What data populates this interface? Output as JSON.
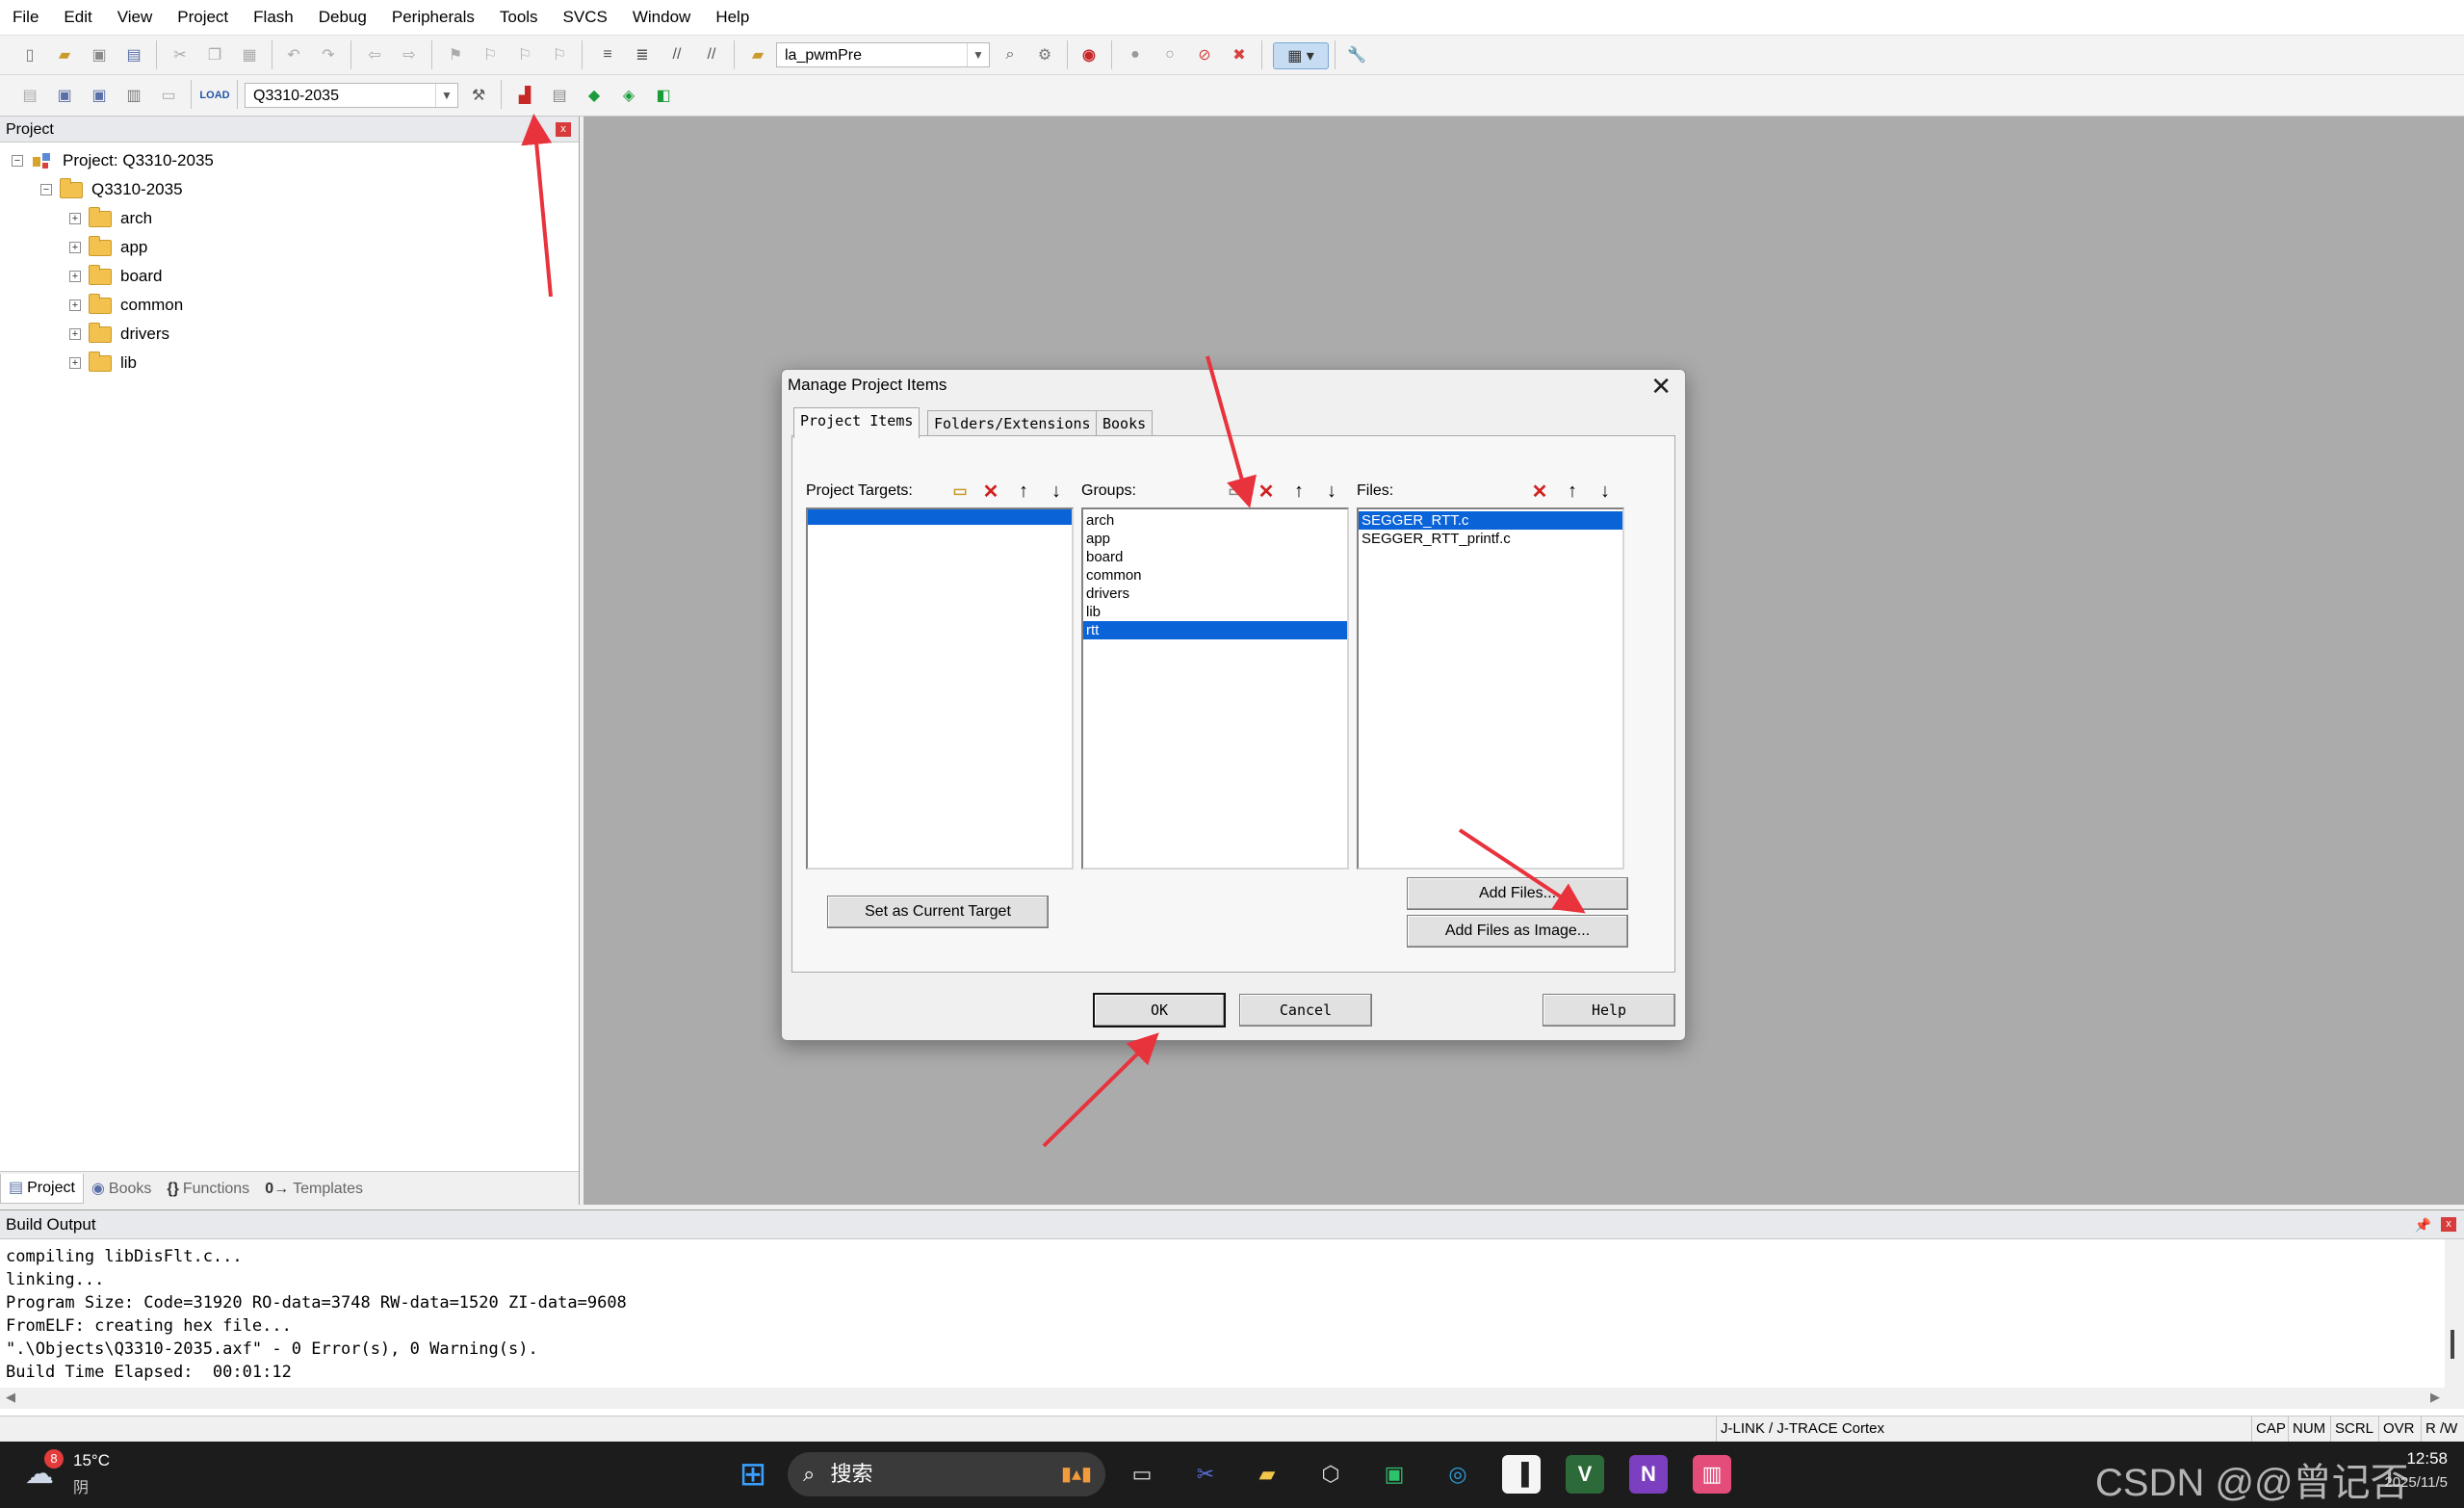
{
  "menu": [
    "File",
    "Edit",
    "View",
    "Project",
    "Flash",
    "Debug",
    "Peripherals",
    "Tools",
    "SVCS",
    "Window",
    "Help"
  ],
  "toolbar1": {
    "target_combo": "la_pwmPre"
  },
  "toolbar2": {
    "target_combo": "Q3310-2035"
  },
  "project_panel": {
    "title": "Project",
    "close_label": "x",
    "root": "Project: Q3310-2035",
    "target": "Q3310-2035",
    "groups": [
      "arch",
      "app",
      "board",
      "common",
      "drivers",
      "lib"
    ],
    "tabs": [
      "Project",
      "Books",
      "Functions",
      "Templates"
    ],
    "tab_icons": [
      "project-icon",
      "books-icon",
      "functions-icon",
      "templates-icon"
    ]
  },
  "dialog": {
    "title": "Manage Project Items",
    "close_label": "✕",
    "tabs": [
      "Project Items",
      "Folders/Extensions",
      "Books"
    ],
    "targets_label": "Project Targets:",
    "groups_label": "Groups:",
    "files_label": "Files:",
    "groups": [
      "arch",
      "app",
      "board",
      "common",
      "drivers",
      "lib",
      "rtt"
    ],
    "selected_group": "rtt",
    "files": [
      "SEGGER_RTT.c",
      "SEGGER_RTT_printf.c"
    ],
    "selected_file": "SEGGER_RTT.c",
    "set_target_button": "Set as Current Target",
    "add_files_button": "Add Files...",
    "add_files_image_button": "Add Files as Image...",
    "ok_button": "OK",
    "cancel_button": "Cancel",
    "help_button": "Help"
  },
  "build_output": {
    "title": "Build Output",
    "lines": [
      "compiling libDisFlt.c...",
      "linking...",
      "Program Size: Code=31920 RO-data=3748 RW-data=1520 ZI-data=9608",
      "FromELF: creating hex file...",
      "\".\\Objects\\Q3310-2035.axf\" - 0 Error(s), 0 Warning(s).",
      "Build Time Elapsed:  00:01:12"
    ]
  },
  "status_bar": {
    "debugger": "J-LINK / J-TRACE Cortex",
    "indicators": [
      "CAP",
      "NUM",
      "SCRL",
      "OVR",
      "R /W"
    ]
  },
  "taskbar": {
    "weather_temp": "15°C",
    "weather_desc": "阴",
    "weather_badge": "8",
    "search_placeholder": "搜索",
    "time": "12:58",
    "date": "2025/11/5",
    "watermark": "CSDN @@曾记否"
  },
  "colors": {
    "selection": "#0a64d8",
    "editor_bg": "#ababab",
    "annotation_arrow": "#e8323c",
    "taskbar_bg": "#1c1c1c"
  }
}
